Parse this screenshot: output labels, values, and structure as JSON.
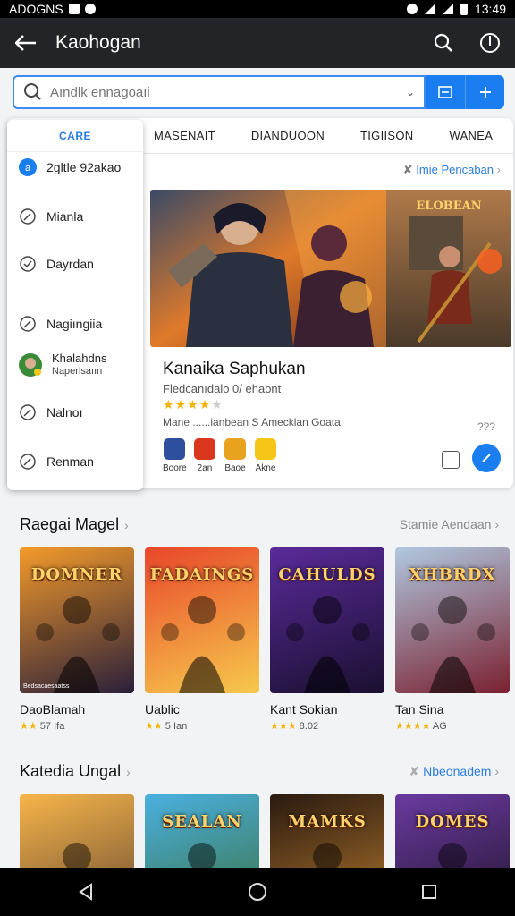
{
  "status_bar": {
    "left_text": "ADOGNS",
    "time": "13:49"
  },
  "app_bar": {
    "title": "Kaohogan"
  },
  "search": {
    "placeholder": "Aındlk ennagoaıi"
  },
  "tabs": [
    "MASENAIT",
    "DIANDUOON",
    "TIGIISON",
    "WANEA"
  ],
  "menu": {
    "header": "CARE",
    "items": [
      {
        "label": "2gltle 92akao",
        "icon": "badge-icon"
      },
      {
        "label": "Mianla",
        "icon": "leaf-icon"
      },
      {
        "label": "Dayrdan",
        "icon": "check-circle-icon"
      },
      {
        "label": "Nagiıngiia",
        "icon": "leaf-icon"
      },
      {
        "label": "Khalahdns",
        "label2": "Naperlsaıın",
        "icon": "avatar-icon"
      },
      {
        "label": "Nalnoı",
        "icon": "leaf-icon"
      },
      {
        "label": "Renman",
        "icon": "leaf-icon"
      }
    ]
  },
  "featured": {
    "promo_link": "Imie Pencaban",
    "title": "Kanaika Saphukan",
    "subtitle": "Fledcanıdalo 0/ ehaont",
    "rating": 4,
    "meta": "Mane ......ianbean S Amecklan Goata",
    "meta_right": "??? ",
    "banner_text": "ELOBEAN",
    "mini_apps": [
      {
        "label": "Boore",
        "color": "#2e4f9e"
      },
      {
        "label": "2an",
        "color": "#d9381e"
      },
      {
        "label": "Baoe",
        "color": "#e8a21d"
      },
      {
        "label": "Akne",
        "color": "#f5c518"
      }
    ]
  },
  "section1": {
    "title": "Raegai Magel",
    "link": "Stamie Aendaan",
    "games": [
      {
        "name": "DaoBlamah",
        "rating": "★★ 57 Ifa",
        "art_text": "DOMNER",
        "bg1": "#f39a2a",
        "bg2": "#2a1f3a",
        "caption": "Bedsacaesaatss"
      },
      {
        "name": "Uablic",
        "rating": "★★ 5 Ian",
        "art_text": "FADAINGS",
        "bg1": "#e8472a",
        "bg2": "#f7c94d"
      },
      {
        "name": "Kant Sokian",
        "rating": "★★★ 8.02",
        "art_text": "CAHULDS",
        "bg1": "#5a2a9a",
        "bg2": "#1a1030"
      },
      {
        "name": "Tan Sina",
        "rating": "★★★★ AG",
        "art_text": "XHBRDX",
        "bg1": "#b0c8e0",
        "bg2": "#7a2030"
      }
    ]
  },
  "section2": {
    "title": "Katedia Ungal",
    "link": "Nbeonadem",
    "games": [
      {
        "art_text": "",
        "bg1": "#f7b54a",
        "bg2": "#5a4030"
      },
      {
        "art_text": "SEALAN",
        "bg1": "#4ab0e0",
        "bg2": "#3a6a30"
      },
      {
        "art_text": "MAMKS",
        "bg1": "#2a1a10",
        "bg2": "#c08030"
      },
      {
        "art_text": "DOMES",
        "bg1": "#6a3aa0",
        "bg2": "#1a1020"
      }
    ]
  },
  "colors": {
    "accent": "#1a7ef0",
    "appbar": "#222427",
    "star": "#f5b301"
  }
}
